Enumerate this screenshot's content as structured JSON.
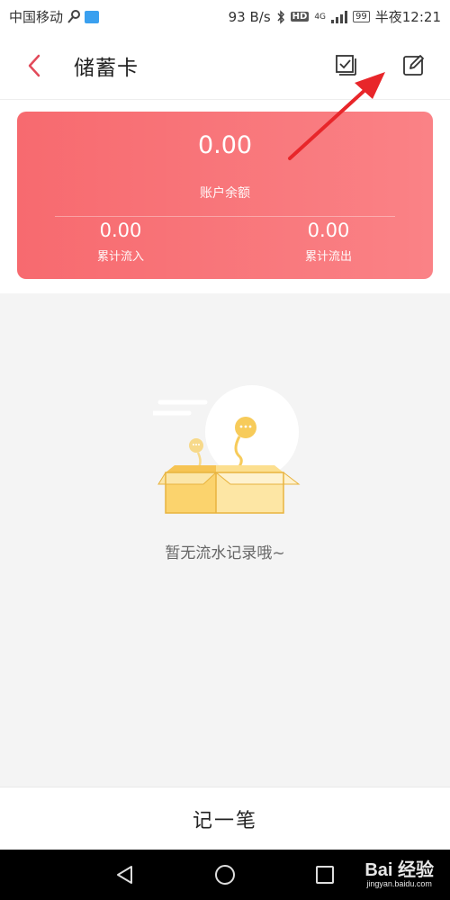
{
  "status_bar": {
    "carrier": "中国移动",
    "network_speed": "93 B/s",
    "signal_label": "4G",
    "hd_label": "HD",
    "battery": "99",
    "time": "半夜12:21"
  },
  "header": {
    "title": "储蓄卡"
  },
  "account": {
    "balance": "0.00",
    "balance_label": "账户余额",
    "inflow": "0.00",
    "inflow_label": "累计流入",
    "outflow": "0.00",
    "outflow_label": "累计流出"
  },
  "empty_state": {
    "message": "暂无流水记录哦~"
  },
  "bottom": {
    "add_label": "记一笔"
  },
  "watermark": {
    "brand": "Bai 经验",
    "site": "jingyan.baidu.com"
  },
  "colors": {
    "card_start": "#f76a6f",
    "card_end": "#fa8286",
    "accent_back": "#e24a5a",
    "annotation_arrow": "#e8262a"
  }
}
